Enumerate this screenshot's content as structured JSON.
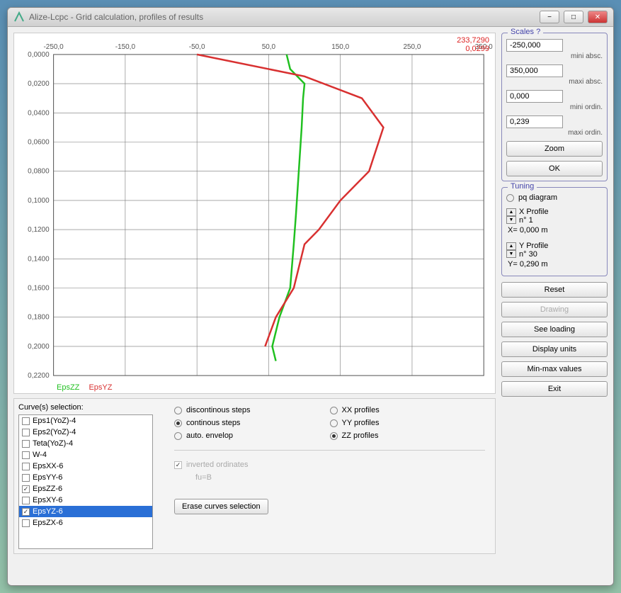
{
  "window": {
    "title": "Alize-Lcpc - Grid calculation, profiles of results"
  },
  "cursor": {
    "line1": "233,7290",
    "line2": "0,0299"
  },
  "x_ticks": [
    "-250,0",
    "-150,0",
    "-50,0",
    "50,0",
    "150,0",
    "250,0",
    "350,0"
  ],
  "y_ticks": [
    "0,0000",
    "0,0200",
    "0,0400",
    "0,0600",
    "0,0800",
    "0,1000",
    "0,1200",
    "0,1400",
    "0,1600",
    "0,1800",
    "0,2000",
    "0,2200"
  ],
  "legend": {
    "green": "EpsZZ",
    "red": "EpsYZ"
  },
  "curves_label": "Curve(s) selection:",
  "curve_items": [
    {
      "label": "Eps1(YoZ)-4",
      "checked": false,
      "selected": false
    },
    {
      "label": "Eps2(YoZ)-4",
      "checked": false,
      "selected": false
    },
    {
      "label": "Teta(YoZ)-4",
      "checked": false,
      "selected": false
    },
    {
      "label": "W-4",
      "checked": false,
      "selected": false
    },
    {
      "label": "EpsXX-6",
      "checked": false,
      "selected": false
    },
    {
      "label": "EpsYY-6",
      "checked": false,
      "selected": false
    },
    {
      "label": "EpsZZ-6",
      "checked": true,
      "selected": false
    },
    {
      "label": "EpsXY-6",
      "checked": false,
      "selected": false
    },
    {
      "label": "EpsYZ-6",
      "checked": true,
      "selected": true
    },
    {
      "label": "EpsZX-6",
      "checked": false,
      "selected": false
    }
  ],
  "step_opts": {
    "discontinous": "discontinous steps",
    "continous": "continous steps",
    "auto": "auto. envelop"
  },
  "profile_opts": {
    "xx": "XX profiles",
    "yy": "YY profiles",
    "zz": "ZZ profiles"
  },
  "inverted": {
    "label": "inverted ordinates",
    "sub": "fu=B"
  },
  "erase_btn": "Erase curves selection",
  "scales": {
    "title": "Scales ?",
    "mini_absc_val": "-250,000",
    "mini_absc": "mini absc.",
    "maxi_absc_val": "350,000",
    "maxi_absc": "maxi absc.",
    "mini_ord_val": "0,000",
    "mini_ord": "mini ordin.",
    "maxi_ord_val": "0,239",
    "maxi_ord": "maxi ordin.",
    "zoom_btn": "Zoom",
    "ok_btn": "OK"
  },
  "tuning": {
    "title": "Tuning",
    "pq": "pq diagram",
    "xprof": "X Profile",
    "xnum": "n° 1",
    "xval": "X= 0,000 m",
    "yprof": "Y Profile",
    "ynum": "n° 30",
    "yval": "Y= 0,290 m"
  },
  "side_buttons": {
    "reset": "Reset",
    "drawing": "Drawing",
    "see_loading": "See loading",
    "display_units": "Display units",
    "minmax": "Min-max values",
    "exit": "Exit"
  },
  "chart_data": {
    "type": "line",
    "xlim": [
      -250,
      350
    ],
    "ylim": [
      0.0,
      0.22
    ],
    "xlabel": "",
    "ylabel": "",
    "series": [
      {
        "name": "EpsZZ",
        "color": "#20c020",
        "points": [
          [
            75,
            0.0
          ],
          [
            80,
            0.01
          ],
          [
            100,
            0.02
          ],
          [
            98,
            0.03
          ],
          [
            96,
            0.05
          ],
          [
            92,
            0.08
          ],
          [
            88,
            0.11
          ],
          [
            85,
            0.13
          ],
          [
            80,
            0.16
          ],
          [
            65,
            0.18
          ],
          [
            55,
            0.2
          ],
          [
            60,
            0.21
          ]
        ]
      },
      {
        "name": "EpsYZ",
        "color": "#d83030",
        "points": [
          [
            -50,
            0.0
          ],
          [
            100,
            0.015
          ],
          [
            180,
            0.03
          ],
          [
            210,
            0.05
          ],
          [
            190,
            0.08
          ],
          [
            150,
            0.1
          ],
          [
            120,
            0.12
          ],
          [
            100,
            0.13
          ],
          [
            85,
            0.16
          ],
          [
            60,
            0.18
          ],
          [
            45,
            0.2
          ]
        ]
      }
    ]
  }
}
